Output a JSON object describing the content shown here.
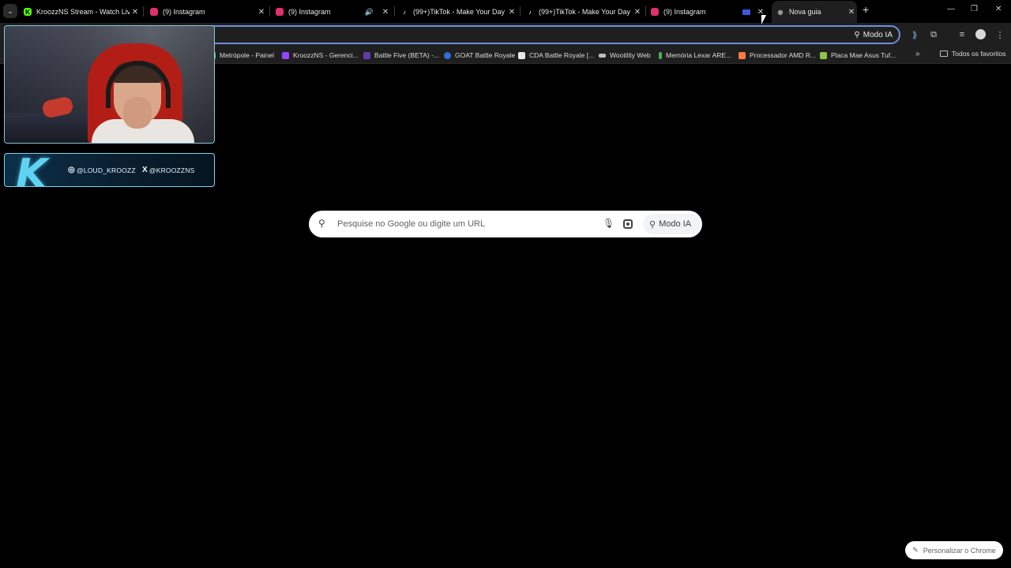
{
  "tabs": [
    {
      "title": "KroozzNS Stream - Watch Live",
      "favicon": "kick-icon",
      "color": "#53fc18"
    },
    {
      "title": "(9) Instagram",
      "favicon": "instagram-icon",
      "color": "#e1306c"
    },
    {
      "title": "(9) Instagram",
      "favicon": "instagram-icon",
      "color": "#e1306c"
    },
    {
      "title": "(99+)TikTok - Make Your Day",
      "favicon": "tiktok-icon",
      "color": "#ffffff"
    },
    {
      "title": "(99+)TikTok - Make Your Day",
      "favicon": "tiktok-icon",
      "color": "#ffffff"
    },
    {
      "title": "(9) Instagram",
      "favicon": "instagram-icon",
      "color": "#e1306c"
    },
    {
      "title": "",
      "favicon": "tab-icon",
      "color": "#3b5bdb"
    },
    {
      "title": "Nova guia",
      "favicon": "chrome-icon",
      "color": "#9aa0a6"
    }
  ],
  "toolbar": {
    "modo_ia_label": "Modo IA"
  },
  "bookmarks": [
    {
      "label": "Metrópole - Painel",
      "color": "#3ddc84"
    },
    {
      "label": "KroozzNS - Gerenci...",
      "color": "#9146ff"
    },
    {
      "label": "Battle Five (BETA) -...",
      "color": "#5b3fa8"
    },
    {
      "label": "GOAT Battle Royale",
      "color": "#2f6fd6"
    },
    {
      "label": "CDA Battle Royale [...",
      "color": "#e8e8e8"
    },
    {
      "label": "Wootility Web",
      "color": "#bfbfbf"
    },
    {
      "label": "Memória Lexar ARE...",
      "color": "#4caf50"
    },
    {
      "label": "Processador AMD R...",
      "color": "#ff7a45"
    },
    {
      "label": "Placa Mae Asus Tuf...",
      "color": "#8bc34a"
    }
  ],
  "bookmarks_folder": "Todos os favoritos",
  "overlay": {
    "logo_letter": "K",
    "instagram_handle": "@LOUD_KROOZZ",
    "x_handle": "@KROOZZNS"
  },
  "search": {
    "placeholder": "Pesquise no Google ou digite um URL",
    "modo_ia_label": "Modo IA"
  },
  "customize_label": "Personalizar o Chrome",
  "colors": {
    "background": "#000000",
    "omnibox_border": "#6e8fdc",
    "overlay_accent": "#5fd4f2"
  }
}
